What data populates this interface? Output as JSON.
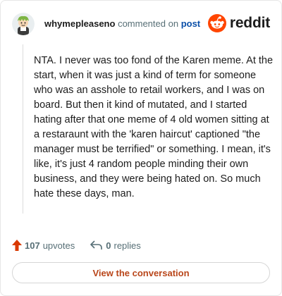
{
  "header": {
    "username": "whymepleaseno",
    "verb": "commented on",
    "post_link": "post",
    "brand": "reddit"
  },
  "comment": {
    "text": "NTA. I never was too fond of the Karen meme. At the start, when it was just a kind of term for someone who was an asshole to retail workers, and I was on board. But then it kind of mutated, and I started hating after that one meme of 4 old women sitting at a restaraunt with the 'karen haircut' captioned \"the manager must be terrified\" or something. I mean, it's like, it's just 4 random people minding their own business, and they were being hated on. So much hate these days, man."
  },
  "footer": {
    "upvotes_count": "107",
    "upvotes_word": "upvotes",
    "replies_count": "0",
    "replies_word": "replies"
  },
  "cta": {
    "label": "View the conversation"
  },
  "icons": {
    "avatar": "user-avatar",
    "brand": "reddit-logo-icon",
    "upvote": "upvote-arrow-icon",
    "reply": "reply-arrow-icon"
  },
  "colors": {
    "brand": "#ff4500",
    "upvote": "#d93900",
    "link": "#0a4fa8",
    "cta_text": "#b9461a",
    "muted": "#576f76"
  }
}
